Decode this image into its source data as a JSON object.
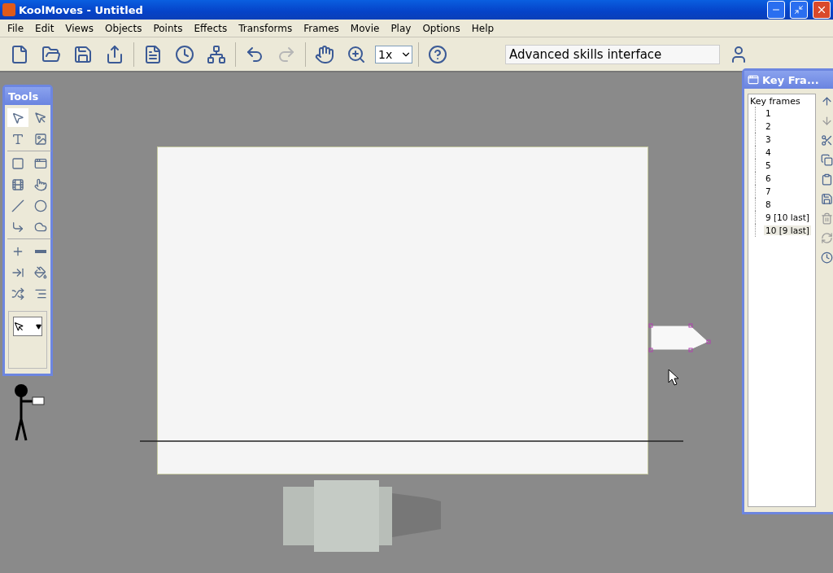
{
  "window": {
    "title": "KoolMoves - Untitled"
  },
  "menu": [
    "File",
    "Edit",
    "Views",
    "Objects",
    "Points",
    "Effects",
    "Transforms",
    "Frames",
    "Movie",
    "Play",
    "Options",
    "Help"
  ],
  "toolbar": [
    {
      "kind": "new",
      "disabled": false
    },
    {
      "kind": "open",
      "disabled": false
    },
    {
      "kind": "save",
      "disabled": false
    },
    {
      "kind": "export",
      "disabled": false
    },
    {
      "kind": "sep"
    },
    {
      "kind": "list",
      "disabled": false
    },
    {
      "kind": "clock",
      "disabled": false
    },
    {
      "kind": "tree",
      "disabled": false
    },
    {
      "kind": "sep"
    },
    {
      "kind": "undo",
      "disabled": false
    },
    {
      "kind": "redo",
      "disabled": true
    },
    {
      "kind": "sep"
    },
    {
      "kind": "hand",
      "disabled": false
    },
    {
      "kind": "zoom",
      "disabled": false
    }
  ],
  "zoom_select": {
    "value": "1x"
  },
  "interface_field": {
    "value": "Advanced skills interface"
  },
  "tools_panel": {
    "title": "Tools",
    "tools": [
      {
        "kind": "select",
        "selected": true
      },
      {
        "kind": "subselect",
        "selected": false
      },
      {
        "kind": "text",
        "selected": false
      },
      {
        "kind": "image",
        "selected": false
      },
      {
        "kind": "sep"
      },
      {
        "kind": "button",
        "selected": false
      },
      {
        "kind": "frame",
        "selected": false
      },
      {
        "kind": "film",
        "selected": false
      },
      {
        "kind": "pointer",
        "selected": false
      },
      {
        "kind": "line",
        "selected": false
      },
      {
        "kind": "circle",
        "selected": false
      },
      {
        "kind": "corner",
        "selected": false
      },
      {
        "kind": "blob",
        "selected": false
      },
      {
        "kind": "sep"
      },
      {
        "kind": "add",
        "selected": false
      },
      {
        "kind": "remove",
        "selected": false
      },
      {
        "kind": "tween",
        "selected": false
      },
      {
        "kind": "fill",
        "selected": false
      },
      {
        "kind": "morph",
        "selected": false
      },
      {
        "kind": "align",
        "selected": false
      }
    ]
  },
  "keyframes_panel": {
    "title": "Key Fra...",
    "tree": {
      "label": "Key frames",
      "children": [
        {
          "label": "1",
          "selected": false
        },
        {
          "label": "2",
          "selected": false
        },
        {
          "label": "3",
          "selected": false
        },
        {
          "label": "4",
          "selected": false
        },
        {
          "label": "5",
          "selected": false
        },
        {
          "label": "6",
          "selected": false
        },
        {
          "label": "7",
          "selected": false
        },
        {
          "label": "8",
          "selected": false
        },
        {
          "label": "9 [10 last]",
          "selected": false
        },
        {
          "label": "10 [9 last]",
          "selected": true
        }
      ]
    },
    "buttons": [
      {
        "kind": "up",
        "disabled": false
      },
      {
        "kind": "down",
        "disabled": true
      },
      {
        "kind": "cut",
        "disabled": false
      },
      {
        "kind": "copy",
        "disabled": false
      },
      {
        "kind": "paste",
        "disabled": false
      },
      {
        "kind": "save",
        "disabled": false
      },
      {
        "kind": "delete",
        "disabled": true
      },
      {
        "kind": "refresh",
        "disabled": true
      },
      {
        "kind": "clock",
        "disabled": false
      }
    ]
  }
}
